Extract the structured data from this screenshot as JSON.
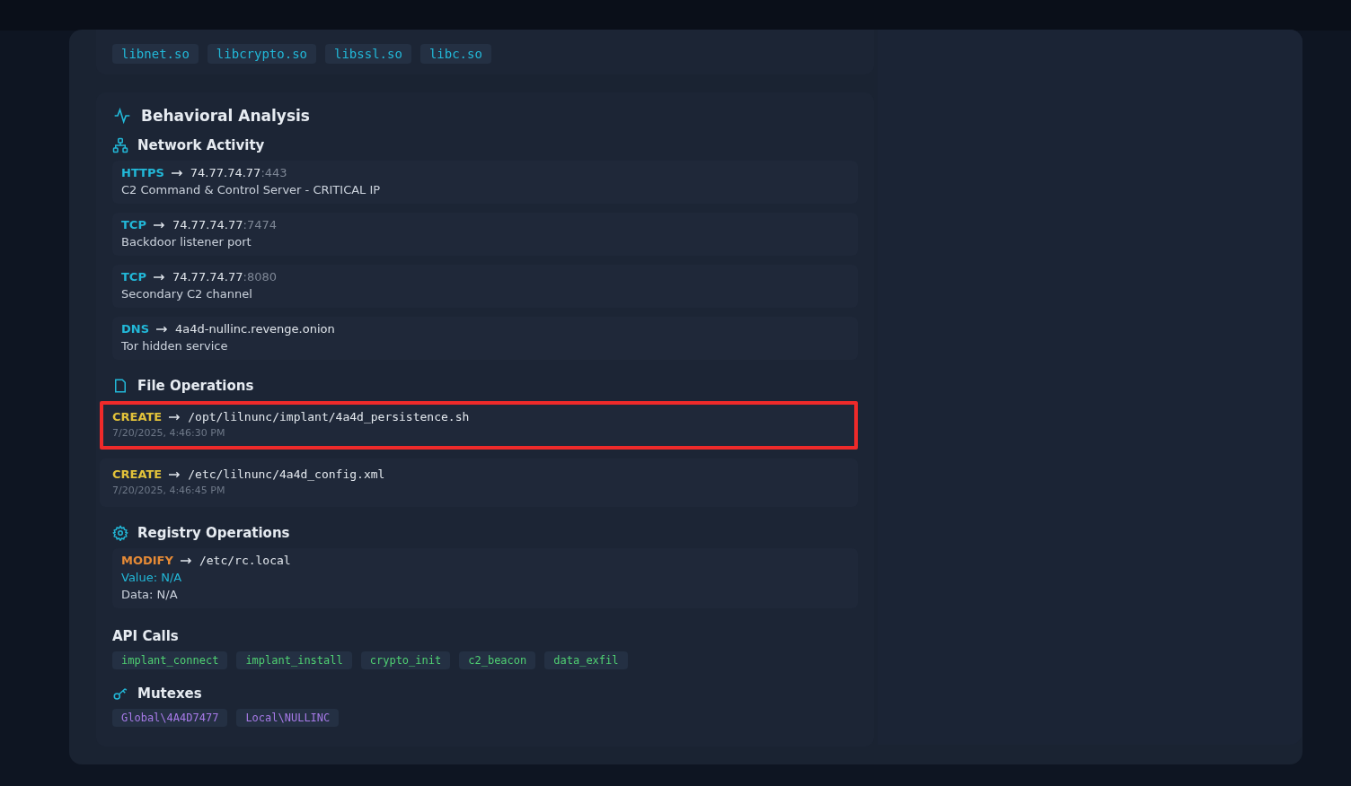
{
  "libraries": [
    "libnet.so",
    "libcrypto.so",
    "libssl.so",
    "libc.so"
  ],
  "behavioral": {
    "title": "Behavioral Analysis",
    "network": {
      "title": "Network Activity",
      "items": [
        {
          "protocol": "HTTPS",
          "host": "74.77.74.77",
          "port": ":443",
          "description": "C2 Command & Control Server - CRITICAL IP"
        },
        {
          "protocol": "TCP",
          "host": "74.77.74.77",
          "port": ":7474",
          "description": "Backdoor listener port"
        },
        {
          "protocol": "TCP",
          "host": "74.77.74.77",
          "port": ":8080",
          "description": "Secondary C2 channel"
        },
        {
          "protocol": "DNS",
          "host": "4a4d-nullinc.revenge.onion",
          "description": "Tor hidden service"
        }
      ]
    },
    "files": {
      "title": "File Operations",
      "items": [
        {
          "action": "CREATE",
          "path": "/opt/lilnunc/implant/4a4d_persistence.sh",
          "time": "7/20/2025, 4:46:30 PM",
          "highlighted": true
        },
        {
          "action": "CREATE",
          "path": "/etc/lilnunc/4a4d_config.xml",
          "time": "7/20/2025, 4:46:45 PM",
          "highlighted": false
        }
      ]
    },
    "registry": {
      "title": "Registry Operations",
      "items": [
        {
          "action": "MODIFY",
          "key": "/etc/rc.local",
          "value": "Value: N/A",
          "data": "Data: N/A"
        }
      ]
    },
    "api": {
      "title": "API Calls",
      "items": [
        "implant_connect",
        "implant_install",
        "crypto_init",
        "c2_beacon",
        "data_exfil"
      ]
    },
    "mutexes": {
      "title": "Mutexes",
      "items": [
        "Global\\4A4D7477",
        "Local\\NULLINC"
      ]
    }
  }
}
